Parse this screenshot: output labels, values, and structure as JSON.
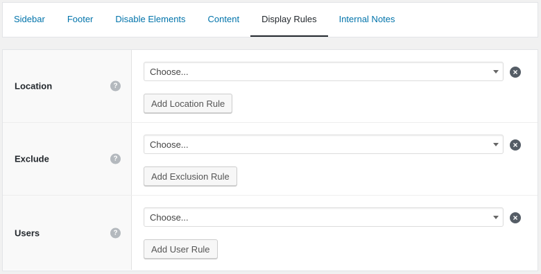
{
  "tabs": [
    {
      "label": "Sidebar"
    },
    {
      "label": "Footer"
    },
    {
      "label": "Disable Elements"
    },
    {
      "label": "Content"
    },
    {
      "label": "Display Rules"
    },
    {
      "label": "Internal Notes"
    }
  ],
  "active_tab": "Display Rules",
  "rules": [
    {
      "label": "Location",
      "help_glyph": "?",
      "select_value": "Choose...",
      "button_label": "Add Location Rule"
    },
    {
      "label": "Exclude",
      "help_glyph": "?",
      "select_value": "Choose...",
      "button_label": "Add Exclusion Rule"
    },
    {
      "label": "Users",
      "help_glyph": "?",
      "select_value": "Choose...",
      "button_label": "Add User Rule"
    }
  ],
  "icons": {
    "help": "question-circle-icon",
    "remove": "remove-circle-icon",
    "dropdown": "chevron-down-icon"
  },
  "colors": {
    "link": "#0073aa",
    "active_tab": "#23282d",
    "remove_icon": "#555d66",
    "help_icon": "#b4b9be"
  }
}
